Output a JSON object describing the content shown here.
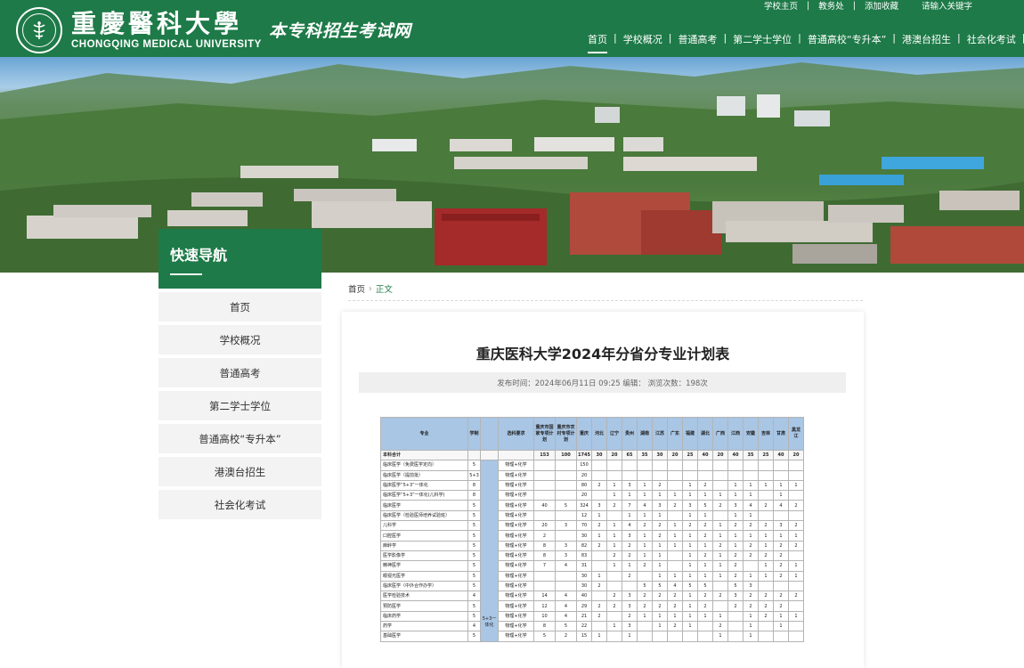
{
  "header": {
    "university_cn": "重慶醫科大學",
    "university_en": "CHONGQING MEDICAL UNIVERSITY",
    "site_name": "本专科招生考试网",
    "top_links": [
      "学校主页",
      "教务处",
      "添加收藏"
    ],
    "search_placeholder": "请输入关键字",
    "nav": [
      {
        "label": "首页",
        "active": true
      },
      {
        "label": "学校概况",
        "active": false
      },
      {
        "label": "普通高考",
        "active": false
      },
      {
        "label": "第二学士学位",
        "active": false
      },
      {
        "label": "普通高校“专升本”",
        "active": false
      },
      {
        "label": "港澳台招生",
        "active": false
      },
      {
        "label": "社会化考试",
        "active": false
      }
    ],
    "brand_color": "#1e7a48"
  },
  "sidebar": {
    "title": "快速导航",
    "items": [
      "首页",
      "学校概况",
      "普通高考",
      "第二学士学位",
      "普通高校“专升本”",
      "港澳台招生",
      "社会化考试"
    ]
  },
  "breadcrumb": {
    "home": "首页",
    "current": "正文"
  },
  "article": {
    "title": "重庆医科大学2024年分省分专业计划表",
    "meta": "发布时间：2024年06月11日 09:25 编辑：   浏览次数：198次"
  },
  "plan_table": {
    "headers": [
      "专业",
      "学制",
      "",
      "选科要求",
      "重庆市国家专项计划",
      "重庆市农村专项计划",
      "重庆",
      "河北",
      "辽宁",
      "贵州",
      "湖南",
      "江苏",
      "广东",
      "福建",
      "湖北",
      "广西",
      "江西",
      "安徽",
      "吉林",
      "甘肃",
      "黑龙江"
    ],
    "mode_label": "5+3一体化",
    "rows": [
      [
        "本科合计",
        "",
        "",
        "",
        "153",
        "100",
        "1745",
        "30",
        "20",
        "65",
        "35",
        "30",
        "20",
        "25",
        "40",
        "20",
        "40",
        "35",
        "25",
        "40",
        "20"
      ],
      [
        "临床医学（免费医学定向）",
        "5",
        "",
        "物理+化学",
        "",
        "",
        "150",
        "",
        "",
        "",
        "",
        "",
        "",
        "",
        "",
        "",
        "",
        "",
        "",
        "",
        ""
      ],
      [
        "临床医学（提前批）",
        "5+3",
        "",
        "物理+化学",
        "",
        "",
        "20",
        "",
        "",
        "",
        "",
        "",
        "",
        "",
        "",
        "",
        "",
        "",
        "",
        "",
        ""
      ],
      [
        "临床医学“5+3”一体化",
        "8",
        "",
        "物理+化学",
        "",
        "",
        "80",
        "2",
        "1",
        "3",
        "1",
        "2",
        "",
        "1",
        "2",
        "",
        "1",
        "1",
        "1",
        "1",
        "1"
      ],
      [
        "临床医学“5+3”一体化(儿科学)",
        "8",
        "",
        "物理+化学",
        "",
        "",
        "20",
        "",
        "1",
        "1",
        "1",
        "1",
        "1",
        "1",
        "1",
        "1",
        "1",
        "1",
        "",
        "1",
        ""
      ],
      [
        "临床医学",
        "5",
        "",
        "物理+化学",
        "40",
        "5",
        "324",
        "3",
        "2",
        "7",
        "4",
        "3",
        "2",
        "3",
        "5",
        "2",
        "3",
        "4",
        "2",
        "4",
        "2"
      ],
      [
        "临床医学（检验医师培养试验班）",
        "5",
        "",
        "物理+化学",
        "",
        "",
        "12",
        "1",
        "",
        "1",
        "1",
        "1",
        "",
        "1",
        "1",
        "",
        "1",
        "1",
        "",
        "",
        ""
      ],
      [
        "儿科学",
        "5",
        "",
        "物理+化学",
        "20",
        "3",
        "70",
        "2",
        "1",
        "4",
        "2",
        "2",
        "1",
        "2",
        "2",
        "1",
        "2",
        "2",
        "2",
        "3",
        "2"
      ],
      [
        "口腔医学",
        "5",
        "",
        "物理+化学",
        "2",
        "",
        "30",
        "1",
        "1",
        "3",
        "1",
        "2",
        "1",
        "1",
        "2",
        "1",
        "1",
        "1",
        "1",
        "1",
        "1"
      ],
      [
        "麻醉学",
        "5",
        "",
        "物理+化学",
        "8",
        "3",
        "82",
        "2",
        "1",
        "2",
        "1",
        "1",
        "1",
        "1",
        "1",
        "2",
        "1",
        "2",
        "1",
        "2",
        "2"
      ],
      [
        "医学影像学",
        "5",
        "",
        "物理+化学",
        "8",
        "3",
        "83",
        "",
        "2",
        "2",
        "1",
        "1",
        "",
        "1",
        "2",
        "1",
        "2",
        "2",
        "2",
        "2",
        ""
      ],
      [
        "精神医学",
        "5",
        "",
        "物理+化学",
        "7",
        "4",
        "31",
        "",
        "1",
        "1",
        "2",
        "1",
        "",
        "1",
        "1",
        "1",
        "2",
        "",
        "1",
        "2",
        "1"
      ],
      [
        "眼视光医学",
        "5",
        "",
        "物理+化学",
        "",
        "",
        "30",
        "1",
        "",
        "2",
        "",
        "1",
        "1",
        "1",
        "1",
        "1",
        "2",
        "1",
        "1",
        "2",
        "1"
      ],
      [
        "临床医学（中外合作办学）",
        "5",
        "",
        "物理+化学",
        "",
        "",
        "30",
        "2",
        "",
        "",
        "5",
        "5",
        "4",
        "5",
        "5",
        "",
        "5",
        "3",
        "",
        "",
        ""
      ],
      [
        "医学检验技术",
        "4",
        "",
        "物理+化学",
        "14",
        "4",
        "40",
        "",
        "2",
        "3",
        "2",
        "2",
        "2",
        "1",
        "2",
        "2",
        "3",
        "2",
        "2",
        "2",
        "2"
      ],
      [
        "预防医学",
        "5",
        "",
        "物理+化学",
        "12",
        "4",
        "29",
        "2",
        "2",
        "3",
        "2",
        "2",
        "2",
        "1",
        "2",
        "",
        "2",
        "2",
        "2",
        "2",
        ""
      ],
      [
        "临床药学",
        "5",
        "",
        "物理+化学",
        "10",
        "4",
        "21",
        "2",
        "",
        "2",
        "1",
        "1",
        "1",
        "1",
        "1",
        "1",
        "",
        "1",
        "2",
        "1",
        "1"
      ],
      [
        "药学",
        "4",
        "",
        "物理+化学",
        "8",
        "5",
        "22",
        "",
        "1",
        "3",
        "",
        "1",
        "2",
        "1",
        "",
        "2",
        "",
        "1",
        "",
        "1",
        ""
      ],
      [
        "基础医学",
        "5",
        "",
        "物理+化学",
        "5",
        "2",
        "15",
        "1",
        "",
        "1",
        "",
        "",
        "",
        "",
        "",
        "1",
        "",
        "1",
        "",
        "",
        ""
      ]
    ]
  }
}
